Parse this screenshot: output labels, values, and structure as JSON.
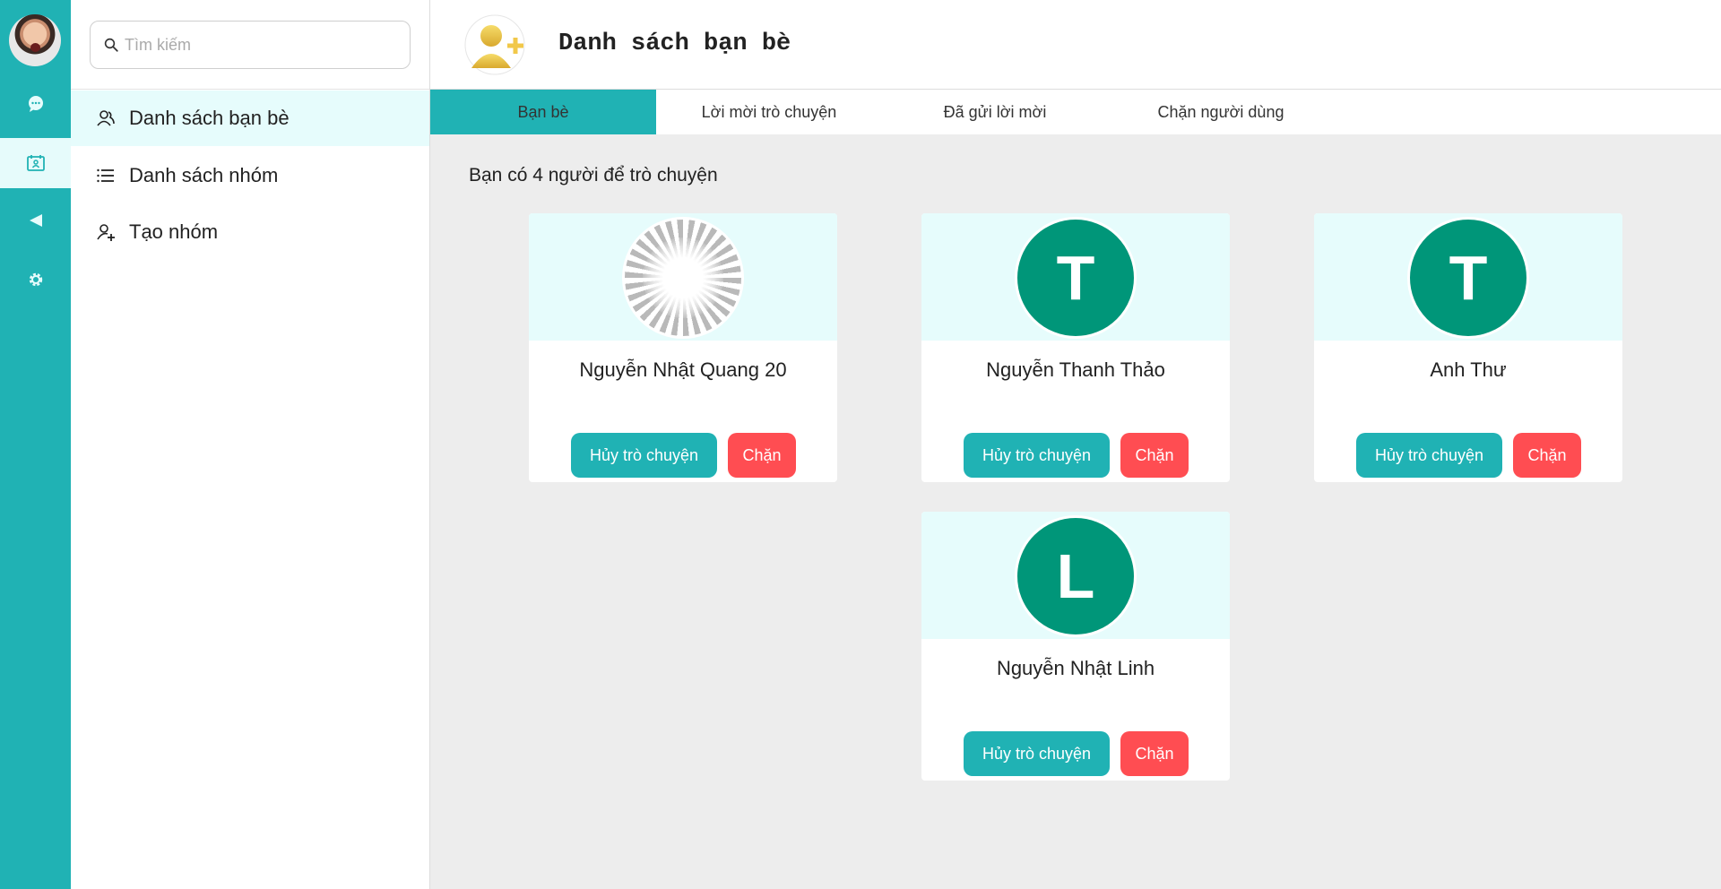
{
  "search": {
    "placeholder": "Tìm kiếm"
  },
  "sidebar": {
    "items": [
      {
        "label": "Danh sách bạn bè",
        "icon": "friends-icon"
      },
      {
        "label": "Danh sách nhóm",
        "icon": "list-icon"
      },
      {
        "label": "Tạo nhóm",
        "icon": "add-user-icon"
      }
    ]
  },
  "rail": {
    "icons": [
      "chat-icon",
      "contacts-icon",
      "megaphone-icon",
      "settings-icon"
    ]
  },
  "header": {
    "title": "Danh sách bạn bè",
    "icon": "add-friend-icon"
  },
  "tabs": [
    "Bạn bè",
    "Lời mời trò chuyện",
    "Đã gửi lời mời",
    "Chặn người dùng"
  ],
  "content": {
    "count_text": "Bạn có 4 người để trò chuyện",
    "friends": [
      {
        "name": "Nguyễn Nhật Quang 20",
        "initial": "",
        "avatar": "burst"
      },
      {
        "name": "Nguyễn Thanh Thảo",
        "initial": "T",
        "avatar": "green"
      },
      {
        "name": "Anh Thư",
        "initial": "T",
        "avatar": "green"
      },
      {
        "name": "Nguyễn Nhật Linh",
        "initial": "L",
        "avatar": "green"
      }
    ],
    "unfriend_label": "Hủy trò chuyện",
    "block_label": "Chặn"
  },
  "colors": {
    "accent": "#20b2b4",
    "block": "#ff4d52",
    "avatar_green": "#009679",
    "highlight": "#e6fcfc"
  }
}
